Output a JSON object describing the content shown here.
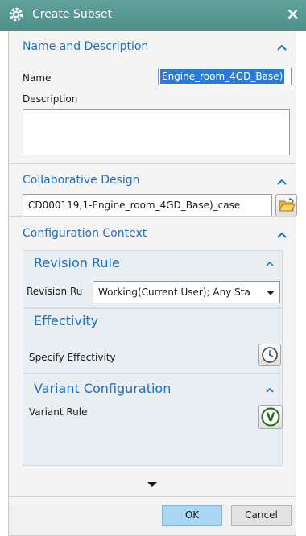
{
  "window": {
    "title": "Create Subset",
    "close_glyph": "×",
    "accent": "#5fa19a"
  },
  "name_desc": {
    "header": "Name and Description",
    "name_label": "Name",
    "name_value": "Engine_room_4GD_Base)",
    "description_label": "Description",
    "description_value": ""
  },
  "collab": {
    "header": "Collaborative Design",
    "value": "CD000119;1-Engine_room_4GD_Base)_case",
    "browse_icon": "open-folder-icon"
  },
  "config": {
    "header": "Configuration Context",
    "revision": {
      "header": "Revision Rule",
      "label": "Revision Ru",
      "value": "Working(Current User); Any Sta"
    },
    "effectivity": {
      "header": "Effectivity",
      "label": "Specify Effectivity",
      "icon": "clock-icon"
    },
    "variant": {
      "header": "Variant Configuration",
      "label": "Variant Rule",
      "icon": "variant-v-icon",
      "icon_letter": "V"
    }
  },
  "footer": {
    "ok_label": "OK",
    "cancel_label": "Cancel"
  },
  "colors": {
    "header_blue": "#2170b8",
    "ok_blue": "#a9d6f3",
    "selection": "#2a7ad6"
  }
}
